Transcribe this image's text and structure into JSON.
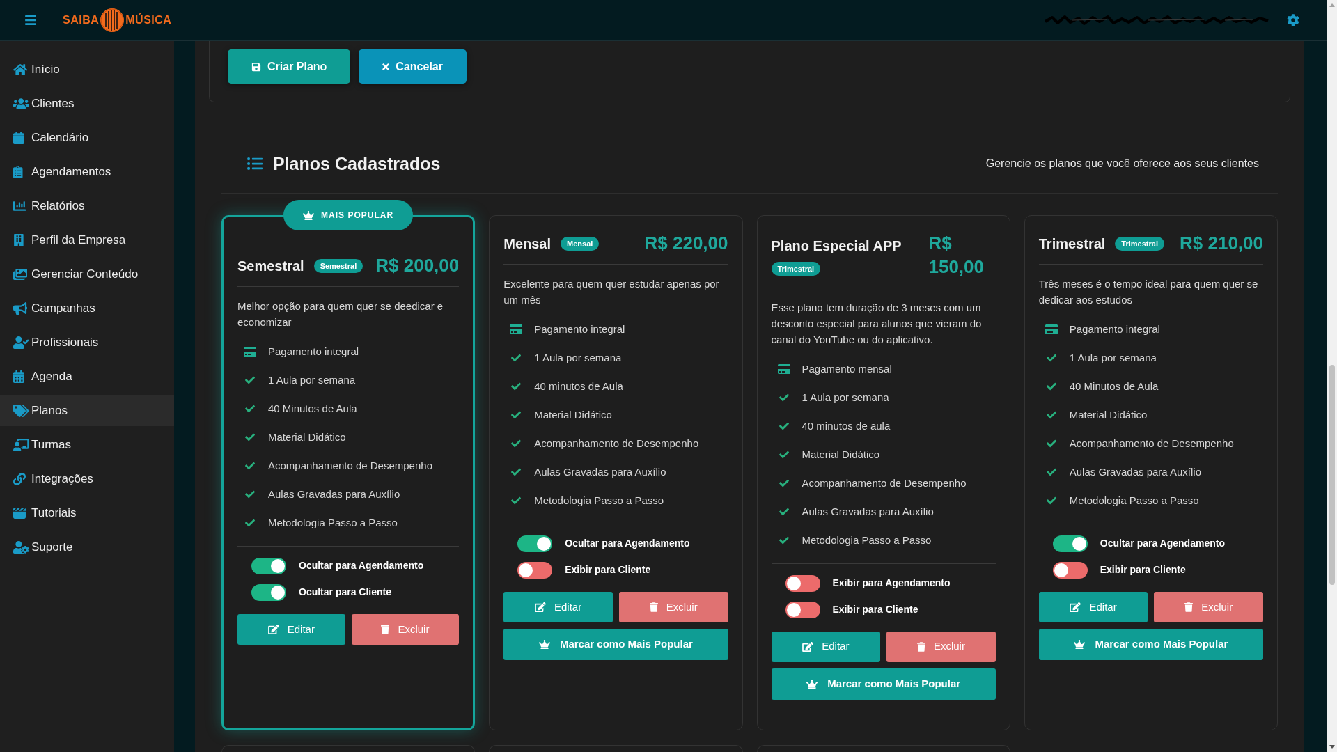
{
  "topbar": {
    "logo": {
      "left": "SAIBA",
      "right": "MÚSICA"
    }
  },
  "sidebar": {
    "items": [
      {
        "label": "Início",
        "selected": false
      },
      {
        "label": "Clientes",
        "selected": false
      },
      {
        "label": "Calendário",
        "selected": false
      },
      {
        "label": "Agendamentos",
        "selected": false
      },
      {
        "label": "Relatórios",
        "selected": false
      },
      {
        "label": "Perfil da Empresa",
        "selected": false
      },
      {
        "label": "Gerenciar Conteúdo",
        "selected": false
      },
      {
        "label": "Campanhas",
        "selected": false
      },
      {
        "label": "Profissionais",
        "selected": false
      },
      {
        "label": "Agenda",
        "selected": false
      },
      {
        "label": "Planos",
        "selected": true
      },
      {
        "label": "Turmas",
        "selected": false
      },
      {
        "label": "Integrações",
        "selected": false
      },
      {
        "label": "Tutoriais",
        "selected": false
      },
      {
        "label": "Suporte",
        "selected": false
      }
    ]
  },
  "form_actions": [
    {
      "kind": "save",
      "label": "Criar Plano"
    },
    {
      "kind": "cancel",
      "label": "Cancelar"
    }
  ],
  "plans_section": {
    "title": "Planos Cadastrados",
    "subtitle": "Gerencie os planos que você oferece aos seus clientes",
    "plans": [
      {
        "name": "Semestral",
        "badge": "Semestral",
        "price": "R$ 200,00",
        "popular": true,
        "popular_badge": "MAIS POPULAR",
        "description": "Melhor opção para quem quer se deedicar e economizar",
        "features": [
          {
            "kind": "payment",
            "text": "Pagamento integral"
          },
          {
            "kind": "check",
            "text": "1 Aula por semana"
          },
          {
            "kind": "check",
            "text": "40 Minutos de Aula"
          },
          {
            "kind": "check",
            "text": "Material Didático"
          },
          {
            "kind": "check",
            "text": "Acompanhamento de Desempenho"
          },
          {
            "kind": "check",
            "text": "Aulas Gravadas para Auxílio"
          },
          {
            "kind": "check",
            "text": "Metodologia Passo a Passo"
          }
        ],
        "toggles": [
          {
            "label": "Ocultar para Agendamento",
            "on": true
          },
          {
            "label": "Ocultar para Cliente",
            "on": true
          }
        ],
        "edit_button": "Editar",
        "delete_button": "Excluir"
      },
      {
        "name": "Mensal",
        "badge": "Mensal",
        "price": "R$ 220,00",
        "popular": false,
        "description": "Excelente para quem quer estudar apenas por um mês",
        "features": [
          {
            "kind": "payment",
            "text": "Pagamento integral"
          },
          {
            "kind": "check",
            "text": "1 Aula por semana"
          },
          {
            "kind": "check",
            "text": "40 minutos de Aula"
          },
          {
            "kind": "check",
            "text": "Material Didático"
          },
          {
            "kind": "check",
            "text": "Acompanhamento de Desempenho"
          },
          {
            "kind": "check",
            "text": "Aulas Gravadas para Auxílio"
          },
          {
            "kind": "check",
            "text": "Metodologia Passo a Passo"
          }
        ],
        "toggles": [
          {
            "label": "Ocultar para Agendamento",
            "on": true
          },
          {
            "label": "Exibir para Cliente",
            "on": false
          }
        ],
        "edit_button": "Editar",
        "delete_button": "Excluir",
        "mark_popular_button": "Marcar como Mais Popular"
      },
      {
        "name": "Plano Especial APP",
        "badge": "Trimestral",
        "price": "R$ 150,00",
        "popular": false,
        "description": "Esse plano tem duração de 3 meses com um desconto especial para alunos que vieram do canal do YouTube ou do aplicativo.",
        "features": [
          {
            "kind": "payment",
            "text": "Pagamento mensal"
          },
          {
            "kind": "check",
            "text": "1 Aula por semana"
          },
          {
            "kind": "check",
            "text": "40 minutos de aula"
          },
          {
            "kind": "check",
            "text": "Material Didático"
          },
          {
            "kind": "check",
            "text": "Acompanhamento de Desempenho"
          },
          {
            "kind": "check",
            "text": "Aulas Gravadas para Auxílio"
          },
          {
            "kind": "check",
            "text": "Metodologia Passo a Passo"
          }
        ],
        "toggles": [
          {
            "label": "Exibir para Agendamento",
            "on": false
          },
          {
            "label": "Exibir para Cliente",
            "on": false
          }
        ],
        "edit_button": "Editar",
        "delete_button": "Excluir",
        "mark_popular_button": "Marcar como Mais Popular"
      },
      {
        "name": "Trimestral",
        "badge": "Trimestral",
        "price": "R$ 210,00",
        "popular": false,
        "description": "Três meses é o tempo ideal para quem quer se dedicar aos estudos",
        "features": [
          {
            "kind": "payment",
            "text": "Pagamento integral"
          },
          {
            "kind": "check",
            "text": "1 Aula por semana"
          },
          {
            "kind": "check",
            "text": "40 Minutos de Aula"
          },
          {
            "kind": "check",
            "text": "Material Didático"
          },
          {
            "kind": "check",
            "text": "Acompanhamento de Desempenho"
          },
          {
            "kind": "check",
            "text": "Aulas Gravadas para Auxílio"
          },
          {
            "kind": "check",
            "text": "Metodologia Passo a Passo"
          }
        ],
        "toggles": [
          {
            "label": "Ocultar para Agendamento",
            "on": true
          },
          {
            "label": "Exibir para Cliente",
            "on": false
          }
        ],
        "edit_button": "Editar",
        "delete_button": "Excluir",
        "mark_popular_button": "Marcar como Mais Popular"
      }
    ]
  }
}
